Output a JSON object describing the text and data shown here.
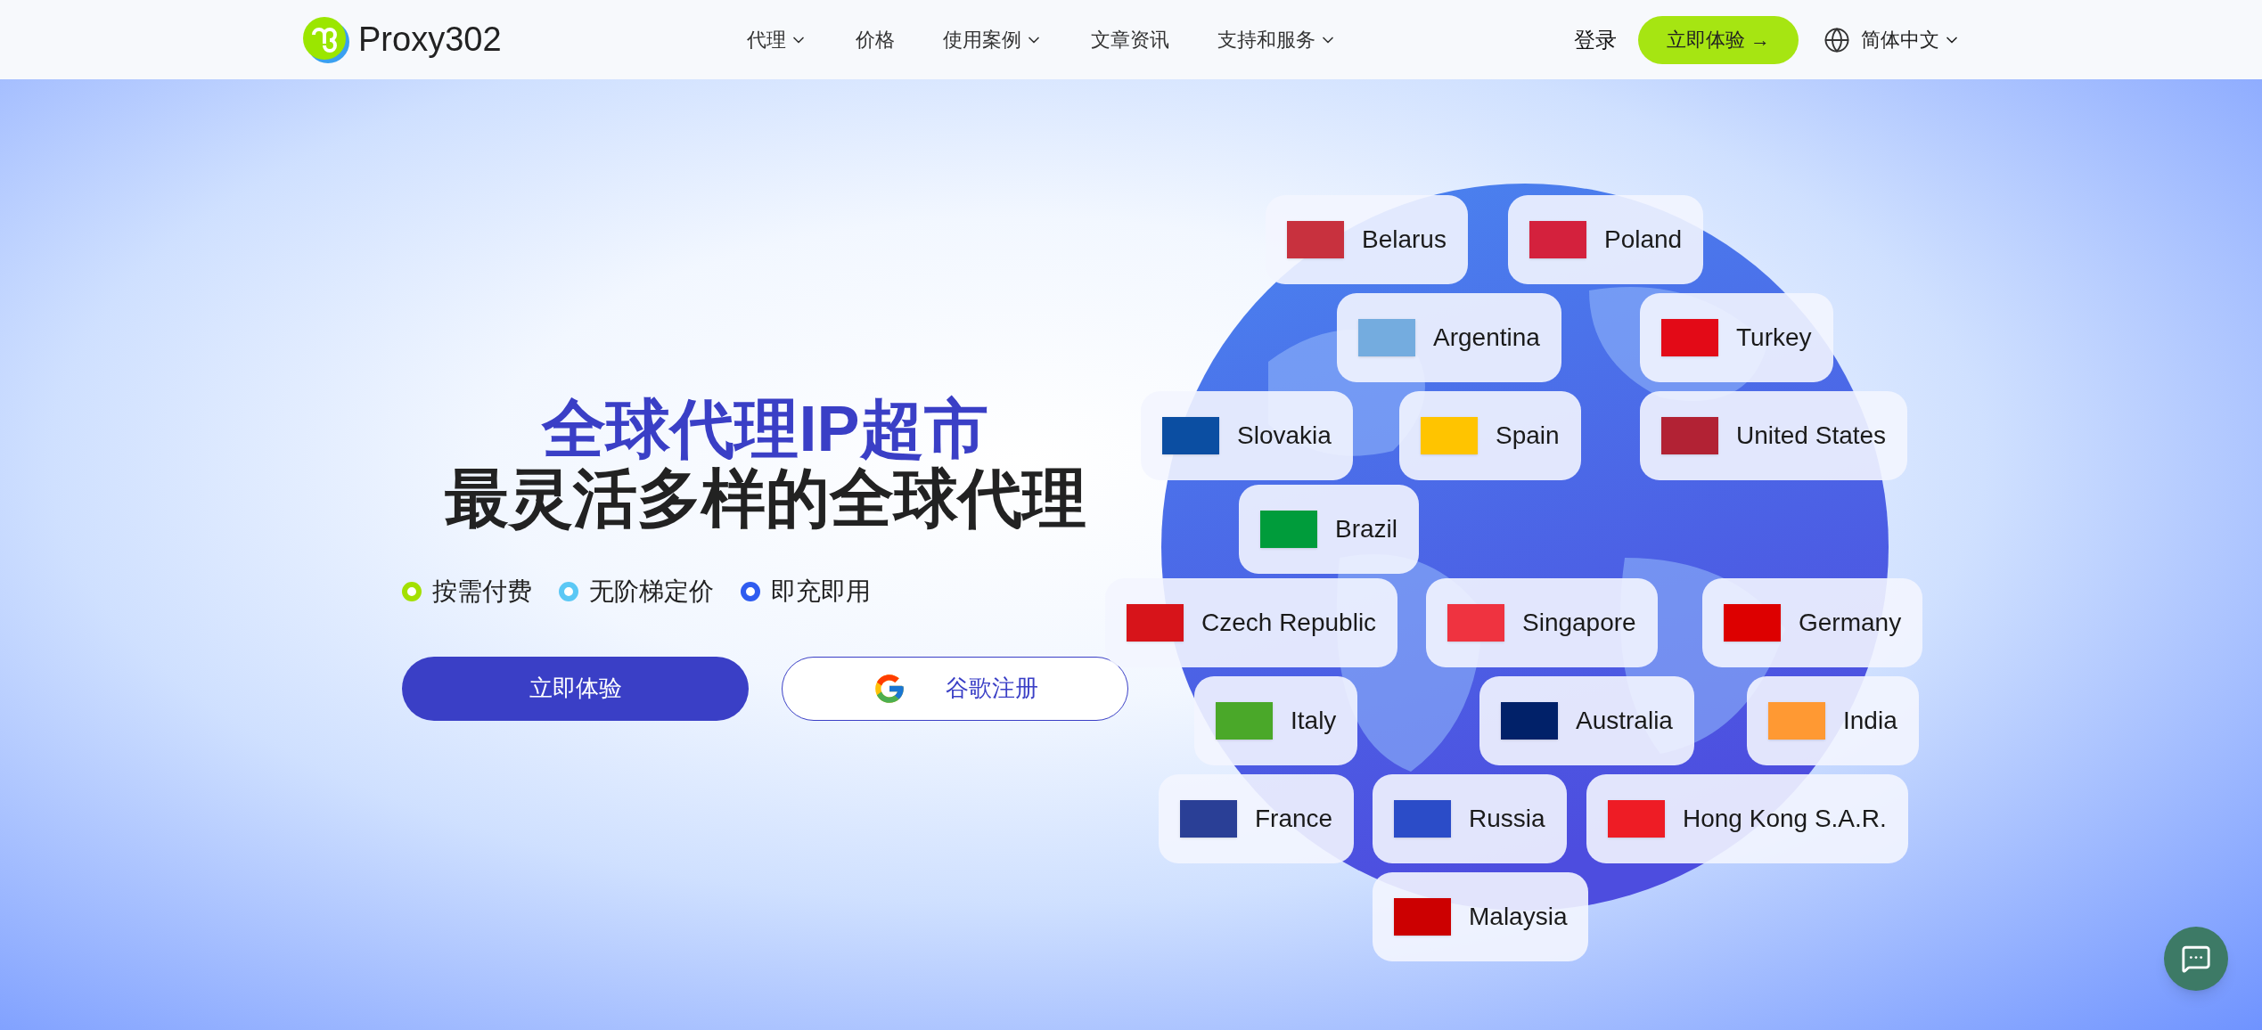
{
  "nav": {
    "logo": "Proxy302",
    "links": [
      {
        "label": "代理",
        "dropdown": true
      },
      {
        "label": "价格",
        "dropdown": false
      },
      {
        "label": "使用案例",
        "dropdown": true
      },
      {
        "label": "文章资讯",
        "dropdown": false
      },
      {
        "label": "支持和服务",
        "dropdown": true
      }
    ],
    "login": "登录",
    "cta": "立即体验 →",
    "language": "简体中文"
  },
  "hero": {
    "title": "全球代理IP超市",
    "subtitle": "最灵活多样的全球代理",
    "features": [
      {
        "label": "按需付费",
        "color": "#a3e000"
      },
      {
        "label": "无阶梯定价",
        "color": "#5bc8f5"
      },
      {
        "label": "即充即用",
        "color": "#2f5cf0"
      }
    ],
    "primary_button": "立即体验",
    "google_button": "谷歌注册"
  },
  "globe": {
    "countries": [
      {
        "name": "Belarus",
        "color": "#c8313e"
      },
      {
        "name": "Poland",
        "color": "#d4213d"
      },
      {
        "name": "Argentina",
        "color": "#74acdf"
      },
      {
        "name": "Turkey",
        "color": "#e30a17"
      },
      {
        "name": "Slovakia",
        "color": "#0b4ea2"
      },
      {
        "name": "Spain",
        "color": "#ffc400"
      },
      {
        "name": "United States",
        "color": "#b22234"
      },
      {
        "name": "Brazil",
        "color": "#009c3b"
      },
      {
        "name": "Czech Republic",
        "color": "#d7141a"
      },
      {
        "name": "Singapore",
        "color": "#ef3340"
      },
      {
        "name": "Germany",
        "color": "#dd0000"
      },
      {
        "name": "Italy",
        "color": "#4aa829"
      },
      {
        "name": "Australia",
        "color": "#012169"
      },
      {
        "name": "India",
        "color": "#ff9933"
      },
      {
        "name": "France",
        "color": "#2a3f96"
      },
      {
        "name": "Russia",
        "color": "#2b4cc8"
      },
      {
        "name": "Hong Kong S.A.R.",
        "color": "#ee1c25"
      },
      {
        "name": "Malaysia",
        "color": "#cc0001"
      }
    ]
  }
}
